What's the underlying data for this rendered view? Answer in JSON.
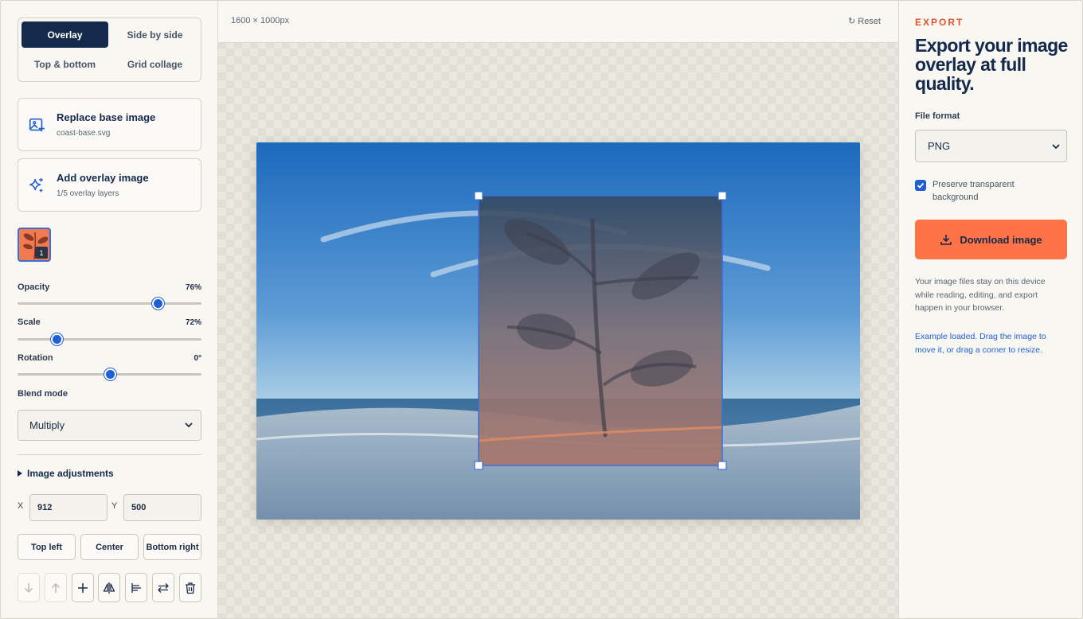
{
  "layout_modes": {
    "overlay": "Overlay",
    "side_by_side": "Side by side",
    "top_bottom": "Top & bottom",
    "grid_collage": "Grid collage",
    "active": "Overlay"
  },
  "base_image": {
    "title": "Replace base image",
    "filename": "coast-base.svg",
    "icon": "image-plus-icon"
  },
  "overlay_image": {
    "title": "Add overlay image",
    "subtitle": "1/5 overlay layers",
    "icon": "sparkles-icon"
  },
  "layers": [
    {
      "index": "1",
      "thumb_color": "#f27a50",
      "selected": true
    }
  ],
  "controls": {
    "opacity": {
      "label": "Opacity",
      "value_text": "76%",
      "value": 76,
      "min": 0,
      "max": 100
    },
    "scale": {
      "label": "Scale",
      "value_text": "72%",
      "value": 72,
      "min": 10,
      "max": 300
    },
    "rotation": {
      "label": "Rotation",
      "value_text": "0°",
      "value": 0,
      "min": -180,
      "max": 180
    }
  },
  "blend_mode": {
    "label": "Blend mode",
    "selected": "Multiply"
  },
  "image_adjustments_label": "Image adjustments",
  "position": {
    "x_label": "X",
    "x_value": "912",
    "y_label": "Y",
    "y_value": "500"
  },
  "position_buttons": {
    "top_left": "Top left",
    "center": "Center",
    "bottom_right": "Bottom right"
  },
  "toolbar_icons": [
    "arrow-down-icon",
    "arrow-up-icon",
    "plus-icon",
    "flip-horizontal-icon",
    "align-icon",
    "swap-icon",
    "trash-icon"
  ],
  "canvas": {
    "dimensions": "1600 × 1000px",
    "reset_label": "Reset",
    "reset_icon": "refresh-icon"
  },
  "export": {
    "eyebrow": "EXPORT",
    "headline": "Export your image overlay at full quality.",
    "file_format_label": "File format",
    "file_format": "PNG",
    "preserve_transparent": true,
    "preserve_label": "Preserve transparent background",
    "download_label": "Download image",
    "privacy_note": "Your image files stay on this device while reading, editing, and export happen in your browser.",
    "hint": "Example loaded. Drag the image to move it, or drag a corner to resize."
  },
  "colors": {
    "primary": "#14294b",
    "accent": "#ff7346",
    "link": "#1f5fd6",
    "eyebrow": "#e0532e"
  }
}
